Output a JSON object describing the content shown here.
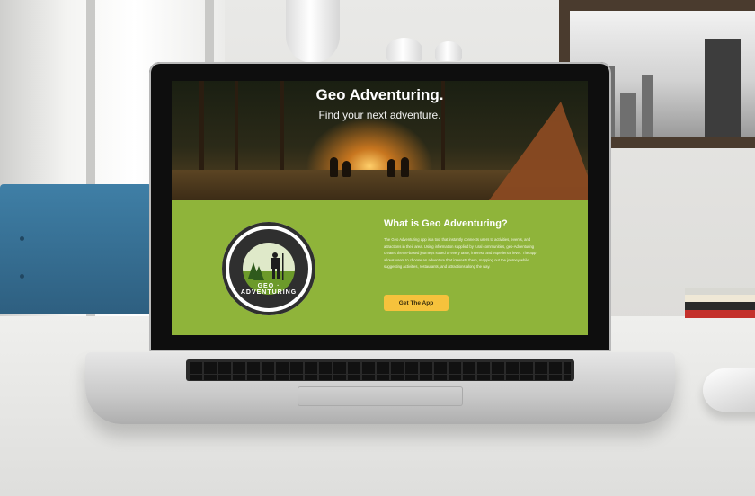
{
  "hero": {
    "title": "Geo Adventuring.",
    "subtitle": "Find your next adventure."
  },
  "about": {
    "heading": "What is Geo Adventuring?",
    "body": "The Geo Adventuring app is a tool that instantly connects users to activities, events, and attractions in their area. Using information supplied by rural communities, geo-Adventuring creates theme-based journeys suited to every taste, interest, and experience level. The app allows users to choose an adventure that interests them, mapping out the journey while suggesting activities, restaurants, and attractions along the way.",
    "button_label": "Get The App"
  },
  "logo": {
    "text": "GEO · ADVENTURING",
    "icon": "hiker-badge-icon"
  },
  "colors": {
    "accent_green": "#8fb43a",
    "button_yellow": "#f6c23c",
    "badge_dark": "#2f2f2f"
  }
}
